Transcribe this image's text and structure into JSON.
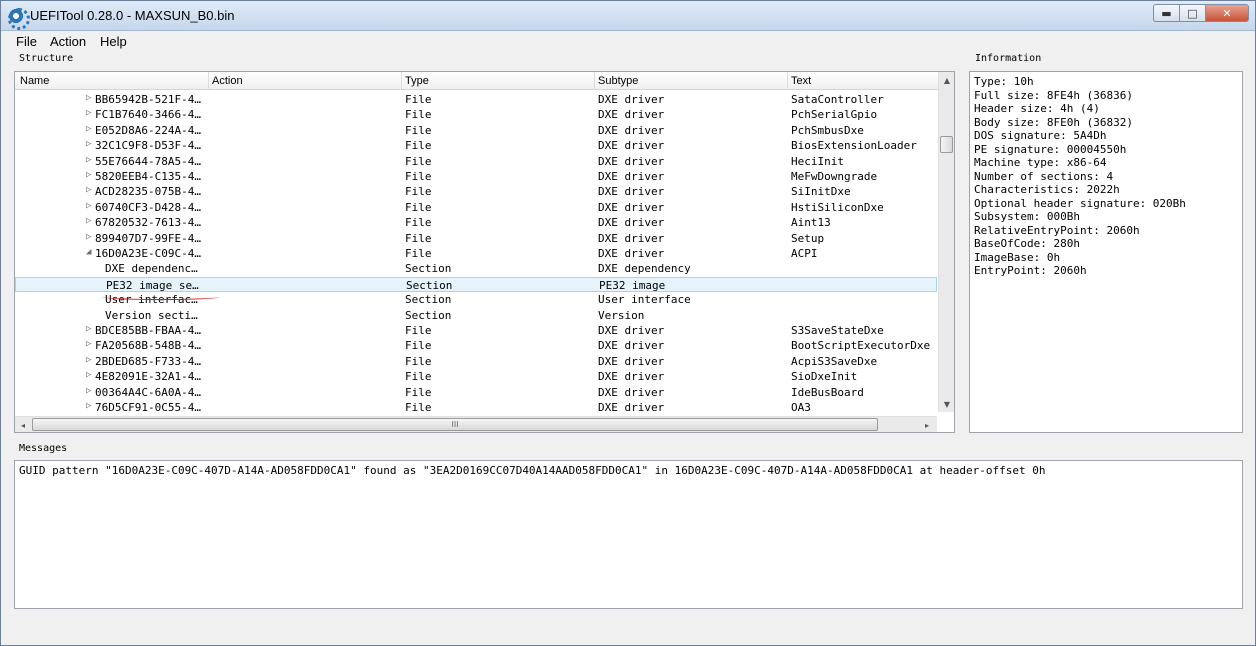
{
  "window": {
    "title": "UEFITool 0.28.0 - MAXSUN_B0.bin",
    "buttons": {
      "minimize": "▬",
      "maximize": "□",
      "close": "✕"
    }
  },
  "menu": [
    "File",
    "Action",
    "Help"
  ],
  "structure": {
    "label": "Structure",
    "columns": [
      "Name",
      "Action",
      "Type",
      "Subtype",
      "Text"
    ],
    "rows": [
      {
        "name": "BB65942B-521F-4…",
        "action": "",
        "type": "File",
        "subtype": "DXE driver",
        "text": "SataController",
        "level": 1,
        "arrow": "right"
      },
      {
        "name": "FC1B7640-3466-4…",
        "action": "",
        "type": "File",
        "subtype": "DXE driver",
        "text": "PchSerialGpio",
        "level": 1,
        "arrow": "right"
      },
      {
        "name": "E052D8A6-224A-4…",
        "action": "",
        "type": "File",
        "subtype": "DXE driver",
        "text": "PchSmbusDxe",
        "level": 1,
        "arrow": "right"
      },
      {
        "name": "32C1C9F8-D53F-4…",
        "action": "",
        "type": "File",
        "subtype": "DXE driver",
        "text": "BiosExtensionLoader",
        "level": 1,
        "arrow": "right"
      },
      {
        "name": "55E76644-78A5-4…",
        "action": "",
        "type": "File",
        "subtype": "DXE driver",
        "text": "HeciInit",
        "level": 1,
        "arrow": "right"
      },
      {
        "name": "5820EEB4-C135-4…",
        "action": "",
        "type": "File",
        "subtype": "DXE driver",
        "text": "MeFwDowngrade",
        "level": 1,
        "arrow": "right"
      },
      {
        "name": "ACD28235-075B-4…",
        "action": "",
        "type": "File",
        "subtype": "DXE driver",
        "text": "SiInitDxe",
        "level": 1,
        "arrow": "right"
      },
      {
        "name": "60740CF3-D428-4…",
        "action": "",
        "type": "File",
        "subtype": "DXE driver",
        "text": "HstiSiliconDxe",
        "level": 1,
        "arrow": "right"
      },
      {
        "name": "67820532-7613-4…",
        "action": "",
        "type": "File",
        "subtype": "DXE driver",
        "text": "Aint13",
        "level": 1,
        "arrow": "right"
      },
      {
        "name": "899407D7-99FE-4…",
        "action": "",
        "type": "File",
        "subtype": "DXE driver",
        "text": "Setup",
        "level": 1,
        "arrow": "right"
      },
      {
        "name": "16D0A23E-C09C-4…",
        "action": "",
        "type": "File",
        "subtype": "DXE driver",
        "text": "ACPI",
        "level": 1,
        "arrow": "down"
      },
      {
        "name": "DXE dependenc…",
        "action": "",
        "type": "Section",
        "subtype": "DXE dependency",
        "text": "",
        "level": 2,
        "arrow": ""
      },
      {
        "name": "PE32 image se…",
        "action": "",
        "type": "Section",
        "subtype": "PE32 image",
        "text": "",
        "level": 2,
        "arrow": "",
        "selected": true
      },
      {
        "name": "User interfac…",
        "action": "",
        "type": "Section",
        "subtype": "User interface",
        "text": "",
        "level": 2,
        "arrow": ""
      },
      {
        "name": "Version secti…",
        "action": "",
        "type": "Section",
        "subtype": "Version",
        "text": "",
        "level": 2,
        "arrow": ""
      },
      {
        "name": "BDCE85BB-FBAA-4…",
        "action": "",
        "type": "File",
        "subtype": "DXE driver",
        "text": "S3SaveStateDxe",
        "level": 1,
        "arrow": "right"
      },
      {
        "name": "FA20568B-548B-4…",
        "action": "",
        "type": "File",
        "subtype": "DXE driver",
        "text": "BootScriptExecutorDxe",
        "level": 1,
        "arrow": "right"
      },
      {
        "name": "2BDED685-F733-4…",
        "action": "",
        "type": "File",
        "subtype": "DXE driver",
        "text": "AcpiS3SaveDxe",
        "level": 1,
        "arrow": "right"
      },
      {
        "name": "4E82091E-32A1-4…",
        "action": "",
        "type": "File",
        "subtype": "DXE driver",
        "text": "SioDxeInit",
        "level": 1,
        "arrow": "right"
      },
      {
        "name": "00364A4C-6A0A-4…",
        "action": "",
        "type": "File",
        "subtype": "DXE driver",
        "text": "IdeBusBoard",
        "level": 1,
        "arrow": "right"
      },
      {
        "name": "76D5CF91-0C55-4…",
        "action": "",
        "type": "File",
        "subtype": "DXE driver",
        "text": "OA3",
        "level": 1,
        "arrow": "right"
      }
    ],
    "scroll_glyphs": {
      "up": "▲",
      "down": "▼",
      "left": "◂",
      "right": "▸",
      "grip_h": "III"
    }
  },
  "information": {
    "label": "Information",
    "lines": [
      "Type: 10h",
      "Full size: 8FE4h (36836)",
      "Header size: 4h (4)",
      "Body size: 8FE0h (36832)",
      "DOS signature: 5A4Dh",
      "PE signature: 00004550h",
      "Machine type: x86-64",
      "Number of sections: 4",
      "Characteristics: 2022h",
      "Optional header signature: 020Bh",
      "Subsystem: 000Bh",
      "RelativeEntryPoint: 2060h",
      "BaseOfCode: 280h",
      "ImageBase: 0h",
      "EntryPoint: 2060h"
    ]
  },
  "messages": {
    "label": "Messages",
    "lines": [
      "GUID pattern \"16D0A23E-C09C-407D-A14A-AD058FDD0CA1\" found as \"3EA2D0169CC07D40A14AAD058FDD0CA1\" in 16D0A23E-C09C-407D-A14A-AD058FDD0CA1 at header-offset 0h"
    ]
  },
  "colors": {
    "selection_bg": "#e5f3fb",
    "selection_border": "#a6d4ef",
    "annotation": "#d21818"
  }
}
